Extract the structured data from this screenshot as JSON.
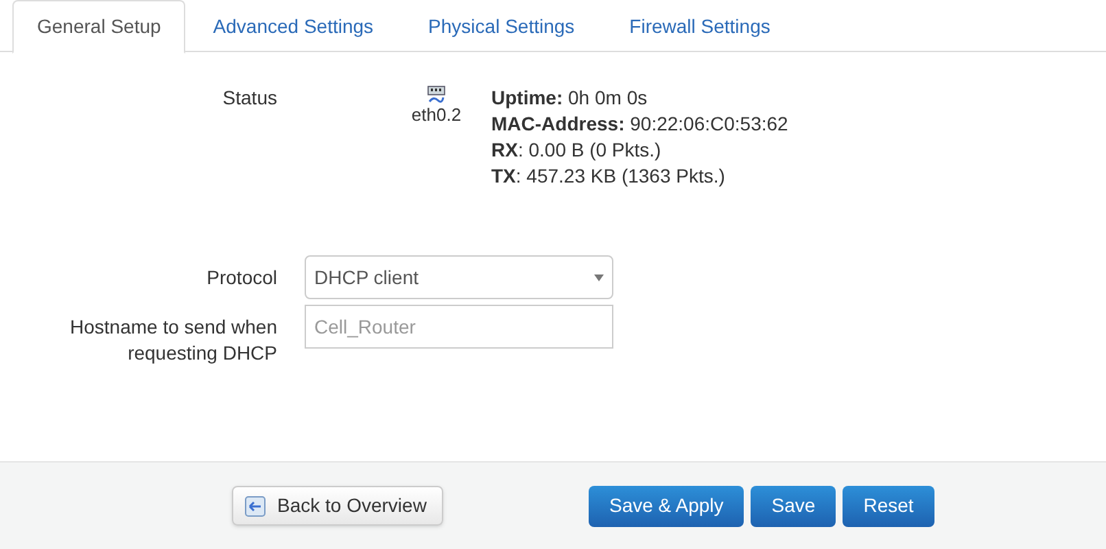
{
  "tabs": [
    {
      "label": "General Setup",
      "selected": true
    },
    {
      "label": "Advanced Settings",
      "selected": false
    },
    {
      "label": "Physical Settings",
      "selected": false
    },
    {
      "label": "Firewall Settings",
      "selected": false
    }
  ],
  "status": {
    "label": "Status",
    "interface": "eth0.2",
    "lines": [
      "**Uptime:** 0h 0m 0s",
      "**MAC-Address:** 90:22:06:C0:53:62",
      "**RX**: 0.00 B (0 Pkts.)",
      "**TX**: 457.23 KB (1363 Pkts.)"
    ]
  },
  "protocol": {
    "label": "Protocol",
    "value": "DHCP client"
  },
  "hostname": {
    "label": "Hostname to send when requesting DHCP",
    "placeholder": "Cell_Router"
  },
  "footer": {
    "back_button": "Back to Overview",
    "buttons": [
      "Save & Apply",
      "Save",
      "Reset"
    ]
  }
}
